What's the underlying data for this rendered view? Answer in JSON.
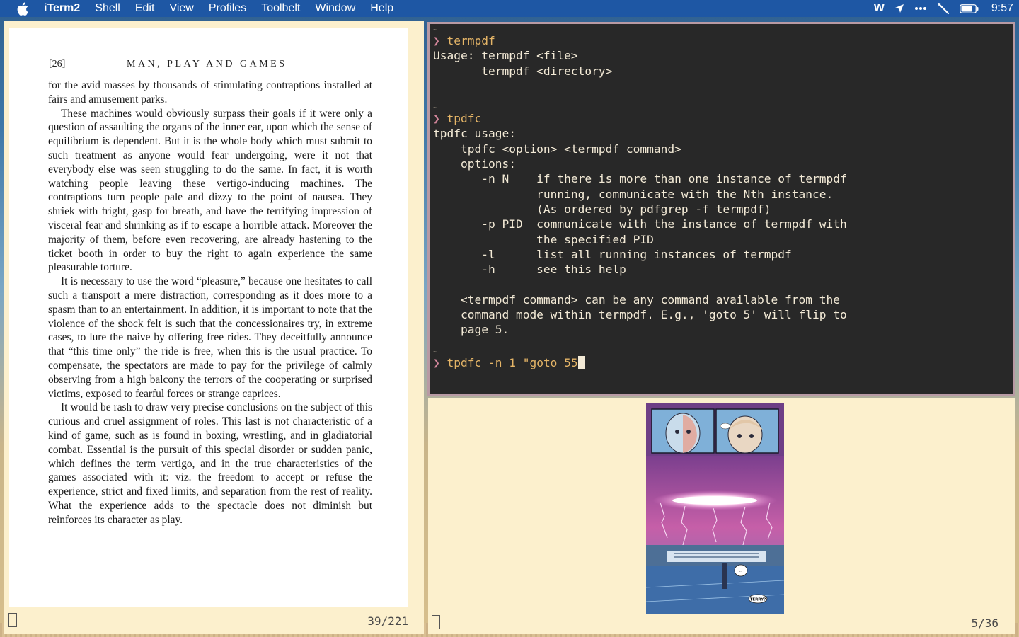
{
  "menubar": {
    "app_name": "iTerm2",
    "items": [
      "Shell",
      "Edit",
      "View",
      "Profiles",
      "Toolbelt",
      "Window",
      "Help"
    ],
    "status_w": "W",
    "clock": "9:57",
    "icons": [
      "apple-icon",
      "location-arrow-icon",
      "more-dots-icon",
      "wand-icon",
      "battery-icon"
    ]
  },
  "pdf_page": {
    "page_number": "[26]",
    "running_title": "MAN, PLAY AND GAMES",
    "paragraphs": [
      "for the avid masses by thousands of stimulating contraptions installed at fairs and amusement parks.",
      "These machines would obviously surpass their goals if it were only a question of assaulting the organs of the inner ear, upon which the sense of equilibrium is dependent. But it is the whole body which must submit to such treatment as anyone would fear undergoing, were it not that everybody else was seen struggling to do the same. In fact, it is worth watching people leaving these vertigo-inducing machines. The contraptions turn people pale and dizzy to the point of nausea. They shriek with fright, gasp for breath, and have the terrifying impression of visceral fear and shrinking as if to escape a horrible attack. Moreover the majority of them, before even recovering, are already hastening to the ticket booth in order to buy the right to again experience the same pleasurable torture.",
      "It is necessary to use the word “pleasure,” because one hesitates to call such a transport a mere distraction, corresponding as it does more to a spasm than to an entertainment. In addition, it is important to note that the violence of the shock felt is such that the concessionaires try, in extreme cases, to lure the naive by offering free rides. They deceitfully announce that “this time only” the ride is free, when this is the usual practice. To compensate, the spectators are made to pay for the privilege of calmly observing from a high balcony the terrors of the cooperating or surprised victims, exposed to fearful forces or strange caprices.",
      "It would be rash to draw very precise conclusions on the subject of this curious and cruel assignment of roles. This last is not characteristic of a kind of game, such as is found in boxing, wrestling, and in gladiatorial combat. Essential is the pursuit of this special disorder or sudden panic, which defines the term vertigo, and in the true characteristics of the games associated with it: viz. the freedom to accept or refuse the experience, strict and fixed limits, and separation from the rest of reality. What the experience adds to the spectacle does not diminish but reinforces its character as play."
    ],
    "counter": "39/221"
  },
  "terminal": {
    "tilde": "~",
    "prompt_symbol": "❯",
    "cmd1": "termpdf",
    "usage1": "Usage: termpdf <file>",
    "usage2": "       termpdf <directory>",
    "cmd2": "tpdfc",
    "out1": "tpdfc usage:",
    "out2": "    tpdfc <option> <termpdf command>",
    "out3": "    options:",
    "out4": "       -n N    if there is more than one instance of termpdf",
    "out5": "               running, communicate with the Nth instance.",
    "out6": "               (As ordered by pdfgrep -f termpdf)",
    "out7": "       -p PID  communicate with the instance of termpdf with",
    "out8": "               the specified PID",
    "out9": "       -l      list all running instances of termpdf",
    "out10": "       -h      see this help",
    "out11": "    <termpdf command> can be any command available from the",
    "out12": "    command mode within termpdf. E.g., 'goto 5' will flip to",
    "out13": "    page 5.",
    "cmd3": "tpdfc -n 1 \"goto 55"
  },
  "viewer": {
    "counter": "5/36",
    "comic_speech_1": "TERRY?",
    "comic_speech_2": "...",
    "comic_speech_3": "..."
  },
  "colors": {
    "menubar_bg": "#1e57a4",
    "terminal_bg": "#282828",
    "terminal_border": "#b89aa4",
    "prompt": "#d3869b",
    "command": "#e5b567",
    "viewer_bg": "#fcf0cd"
  }
}
